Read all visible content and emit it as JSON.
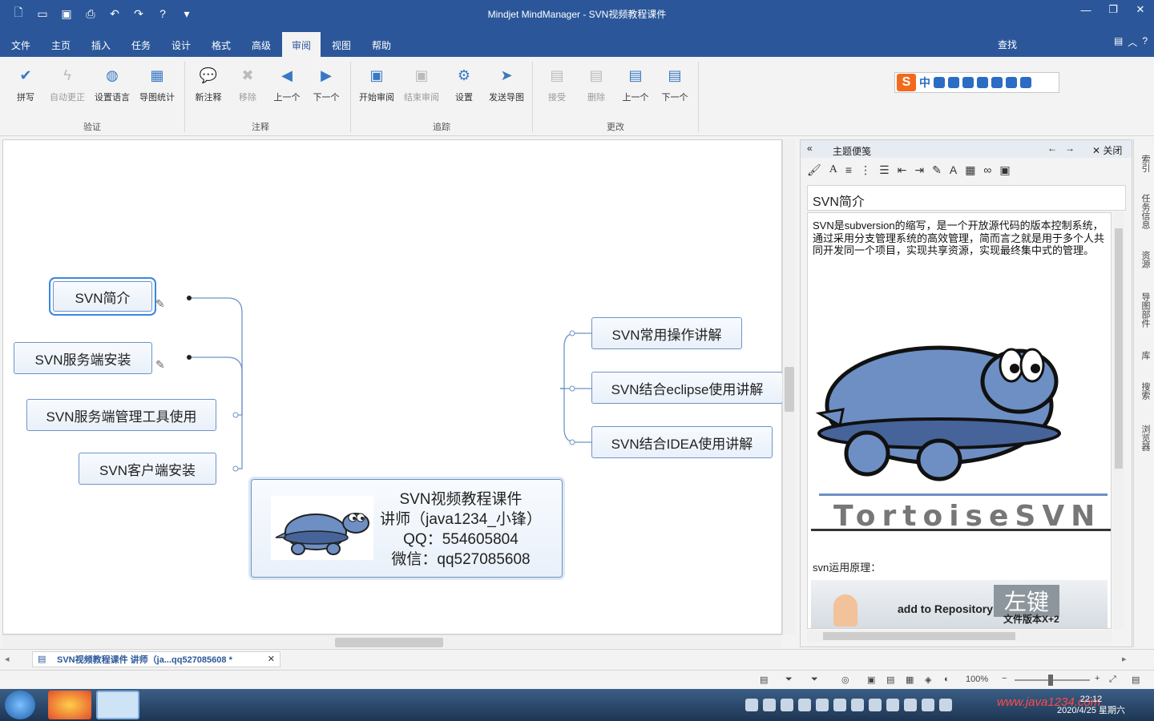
{
  "window": {
    "title": "Mindjet MindManager - SVN视频教程课件"
  },
  "menu": {
    "tabs": [
      "文件",
      "主页",
      "插入",
      "任务",
      "设计",
      "格式",
      "高级",
      "审阅",
      "视图",
      "帮助"
    ],
    "active_tab": "审阅",
    "find": "查找"
  },
  "ribbon": {
    "groups": [
      {
        "label": "验证",
        "buttons": [
          "拼写",
          "自动更正",
          "设置语言",
          "导图统计"
        ]
      },
      {
        "label": "注释",
        "buttons": [
          "新注释",
          "移除",
          "上一个",
          "下一个"
        ]
      },
      {
        "label": "追踪",
        "buttons": [
          "开始审阅",
          "结束审阅",
          "设置",
          "发送导图"
        ]
      },
      {
        "label": "更改",
        "buttons": [
          "接受",
          "删除",
          "上一个",
          "下一个"
        ]
      }
    ]
  },
  "ime": {
    "mode": "中"
  },
  "map": {
    "central": {
      "lines": [
        "SVN视频教程课件",
        "讲师（java1234_小锋）",
        "QQ：554605804",
        "微信：qq527085608"
      ]
    },
    "left_topics": [
      "SVN简介",
      "SVN服务端安装",
      "SVN服务端管理工具使用",
      "SVN客户端安装"
    ],
    "right_topics": [
      "SVN常用操作讲解",
      "SVN结合eclipse使用讲解",
      "SVN结合IDEA使用讲解"
    ]
  },
  "notes": {
    "header": "主题便笺",
    "close": "关闭",
    "title": "SVN简介",
    "paragraph": "SVN是subversion的缩写，是一个开放源代码的版本控制系统，通过采用分支管理系统的高效管理，简而言之就是用于多个人共同开发同一个项目，实现共享资源，实现最终集中式的管理。",
    "image_caption": "TortoiseSVN",
    "subheading": "svn运用原理：",
    "image2_text": "add to Repository",
    "image2_overlay": "左键",
    "image2_sub": "文件版本X+2"
  },
  "side_tabs": [
    "索引",
    "任务信息",
    "资源",
    "导图部件",
    "库",
    "搜索",
    "浏览器"
  ],
  "doc_tab": {
    "label": "SVN视频教程课件 讲师（ja...qq527085608 *"
  },
  "status": {
    "zoom": "100%"
  },
  "taskbar": {
    "time": "22:12",
    "date": "2020/4/25 星期六",
    "watermark": "www.java1234.com"
  }
}
